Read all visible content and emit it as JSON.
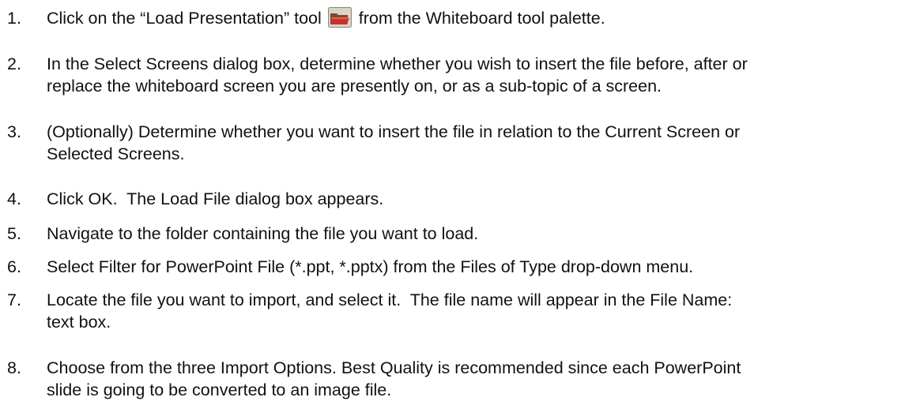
{
  "steps": [
    {
      "number": "1.",
      "before_icon": "Click on the “Load Presentation” tool",
      "icon": "folder-open-icon",
      "after_icon": "from the Whiteboard tool palette."
    },
    {
      "number": "2.",
      "lines": [
        "In the Select Screens dialog box, determine whether you wish to insert the file before, after or",
        "replace the whiteboard screen you are presently on, or as a sub-topic of a screen."
      ]
    },
    {
      "number": "3.",
      "lines": [
        "(Optionally) Determine whether you want to insert the file in relation to the Current Screen or",
        "Selected Screens."
      ]
    },
    {
      "number": "4.",
      "lines": [
        "Click OK.  The Load File dialog box appears."
      ]
    },
    {
      "number": "5.",
      "lines": [
        "Navigate to the folder containing the file you want to load."
      ]
    },
    {
      "number": "6.",
      "lines": [
        "Select Filter for PowerPoint File (*.ppt, *.pptx) from the Files of Type drop-down menu."
      ]
    },
    {
      "number": "7.",
      "lines": [
        "Locate the file you want to import, and select it.  The file name will appear in the File Name:",
        "text box."
      ]
    },
    {
      "number": "8.",
      "lines": [
        "Choose from the three Import Options. Best Quality is recommended since each PowerPoint",
        "slide is going to be converted to an image file."
      ]
    }
  ]
}
